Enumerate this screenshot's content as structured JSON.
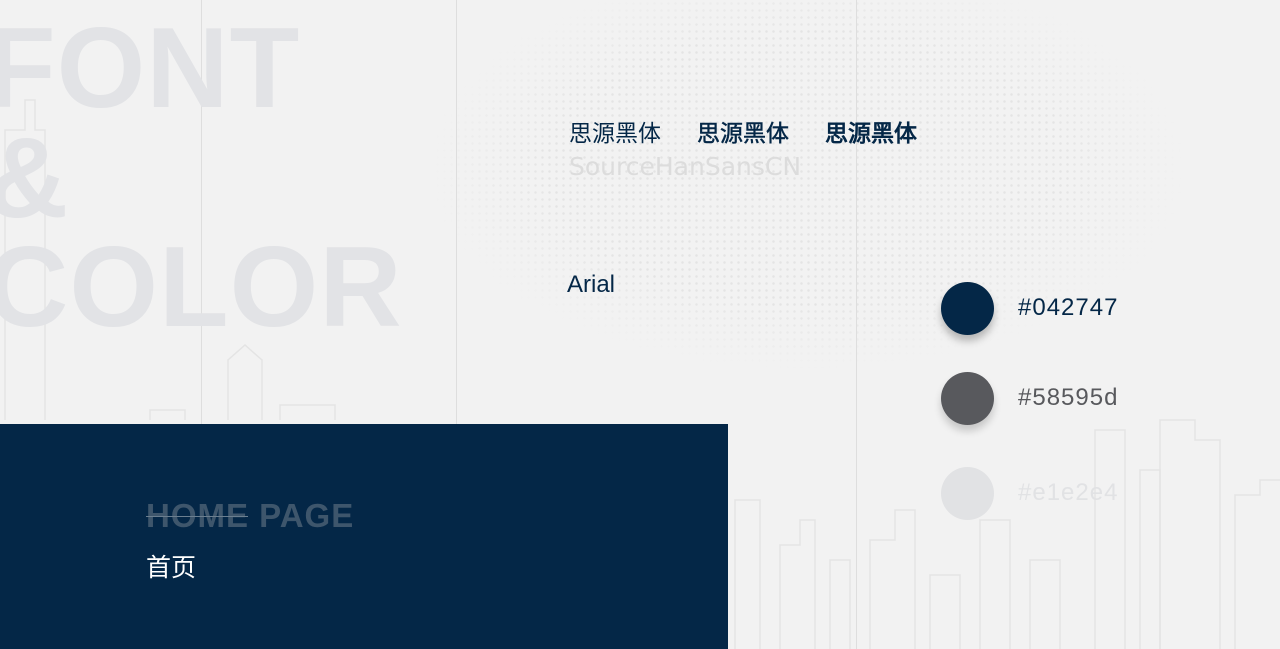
{
  "background": {
    "big_words": [
      "FONT",
      "&",
      "COLOR"
    ]
  },
  "typography": {
    "samples": [
      "思源黑体",
      "思源黑体",
      "思源黑体"
    ],
    "font_name": "SourceHanSansCN",
    "latin_sample": "Arial"
  },
  "palette": [
    {
      "hex": "#042747",
      "label": "#042747",
      "text_color": "#042747"
    },
    {
      "hex": "#58595d",
      "label": "#58595d",
      "text_color": "#58595d"
    },
    {
      "hex": "#e1e2e4",
      "label": "#e1e2e4",
      "text_color": "#e1e2e4"
    }
  ],
  "home": {
    "title_en": "HOME PAGE",
    "title_cn": "首页",
    "panel_color": "#042747"
  }
}
